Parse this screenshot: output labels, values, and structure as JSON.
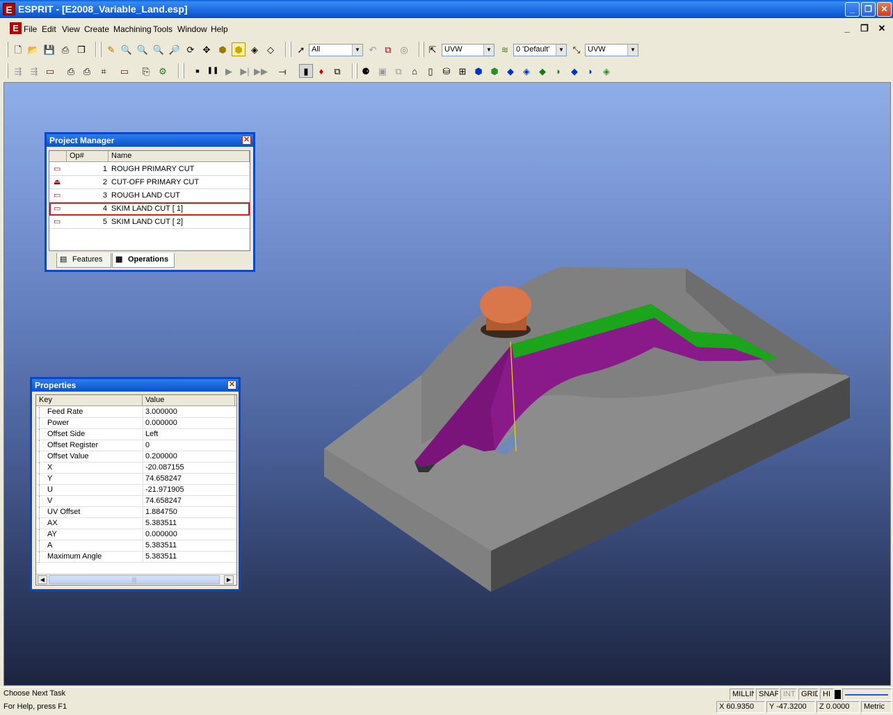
{
  "window": {
    "title": "ESPRIT - [E2008_Variable_Land.esp]",
    "logo_letter": "E",
    "controls": {
      "minimize": "_",
      "restore": "❐",
      "close": "✕"
    }
  },
  "menu": {
    "items": [
      {
        "label": "File"
      },
      {
        "label": "Edit"
      },
      {
        "label": "View"
      },
      {
        "label": "Create"
      },
      {
        "label": "Machining"
      },
      {
        "label": "Tools"
      },
      {
        "label": "Window"
      },
      {
        "label": "Help"
      }
    ],
    "mdi_controls": {
      "minimize": "_",
      "restore": "❐",
      "close": "✕"
    }
  },
  "toolbar": {
    "select_filter": "All",
    "workplane_1": "UVW",
    "layer": "0 'Default'",
    "workplane_2": "UVW"
  },
  "project_manager": {
    "title": "Project Manager",
    "columns": {
      "op": "Op#",
      "name": "Name"
    },
    "rows": [
      {
        "op": "1",
        "name": "ROUGH PRIMARY CUT"
      },
      {
        "op": "2",
        "name": "CUT-OFF PRIMARY CUT"
      },
      {
        "op": "3",
        "name": "ROUGH LAND CUT"
      },
      {
        "op": "4",
        "name": "SKIM LAND CUT [ 1]"
      },
      {
        "op": "5",
        "name": "SKIM LAND CUT [ 2]"
      }
    ],
    "selected_op": "4",
    "tabs": {
      "features": "Features",
      "operations": "Operations"
    }
  },
  "properties": {
    "title": "Properties",
    "columns": {
      "key": "Key",
      "value": "Value"
    },
    "rows": [
      {
        "key": "Feed Rate",
        "value": "3.000000"
      },
      {
        "key": "Power",
        "value": "0.000000"
      },
      {
        "key": "Offset Side",
        "value": "Left"
      },
      {
        "key": "Offset Register",
        "value": "0"
      },
      {
        "key": "Offset Value",
        "value": "0.200000"
      },
      {
        "key": "X",
        "value": "-20.087155"
      },
      {
        "key": "Y",
        "value": "74.658247"
      },
      {
        "key": "U",
        "value": "-21.971905"
      },
      {
        "key": "V",
        "value": "74.658247"
      },
      {
        "key": "UV Offset",
        "value": "1.884750"
      },
      {
        "key": "AX",
        "value": "5.383511"
      },
      {
        "key": "AY",
        "value": "0.000000"
      },
      {
        "key": "A",
        "value": "5.383511"
      },
      {
        "key": "Maximum Angle",
        "value": "5.383511"
      }
    ]
  },
  "status": {
    "task": "Choose Next Task",
    "help": "For Help, press F1",
    "mode": "MILLIN",
    "snap": "SNAP",
    "int": "INT",
    "grid": "GRID",
    "hi": "HI",
    "x": "X 60.9350",
    "y": "Y -47.3200",
    "z": "Z 0.0000",
    "units": "Metric"
  },
  "colors": {
    "part_gray": "#8A8A8A",
    "land_green": "#1BA51B",
    "cut_magenta": "#8A1A8A",
    "tool_orange": "#D9764A",
    "selection_red": "#D42020"
  }
}
